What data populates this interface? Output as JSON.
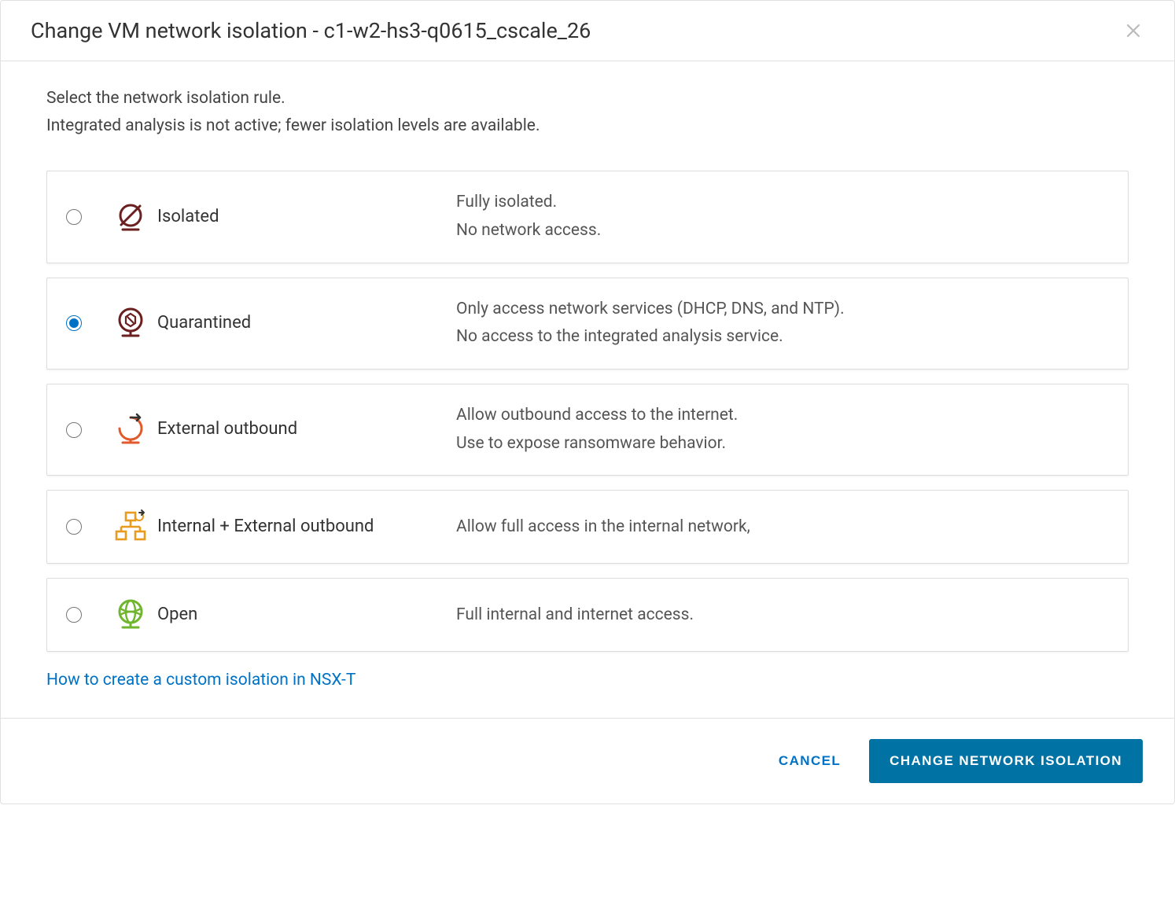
{
  "header": {
    "title": "Change VM network isolation - c1-w2-hs3-q0615_cscale_26"
  },
  "body": {
    "instruction_line1": "Select the network isolation rule.",
    "instruction_line2": "Integrated analysis is not active; fewer isolation levels are available."
  },
  "options": [
    {
      "id": "isolated",
      "label": "Isolated",
      "desc_line1": "Fully isolated.",
      "desc_line2": "No network access.",
      "selected": false
    },
    {
      "id": "quarantined",
      "label": "Quarantined",
      "desc_line1": "Only access network services (DHCP, DNS, and NTP).",
      "desc_line2": "No access to the integrated analysis service.",
      "selected": true
    },
    {
      "id": "external-outbound",
      "label": "External outbound",
      "desc_line1": "Allow outbound access to the internet.",
      "desc_line2": "Use to expose ransomware behavior.",
      "selected": false
    },
    {
      "id": "internal-external",
      "label": "Internal + External outbound",
      "desc_line1": "Allow full access in the internal network,",
      "desc_line2": "",
      "selected": false
    },
    {
      "id": "open",
      "label": "Open",
      "desc_line1": "Full internal and internet access.",
      "desc_line2": "",
      "selected": false
    }
  ],
  "help_link": "How to create a custom isolation in NSX-T",
  "footer": {
    "cancel": "CANCEL",
    "confirm": "CHANGE NETWORK ISOLATION"
  }
}
